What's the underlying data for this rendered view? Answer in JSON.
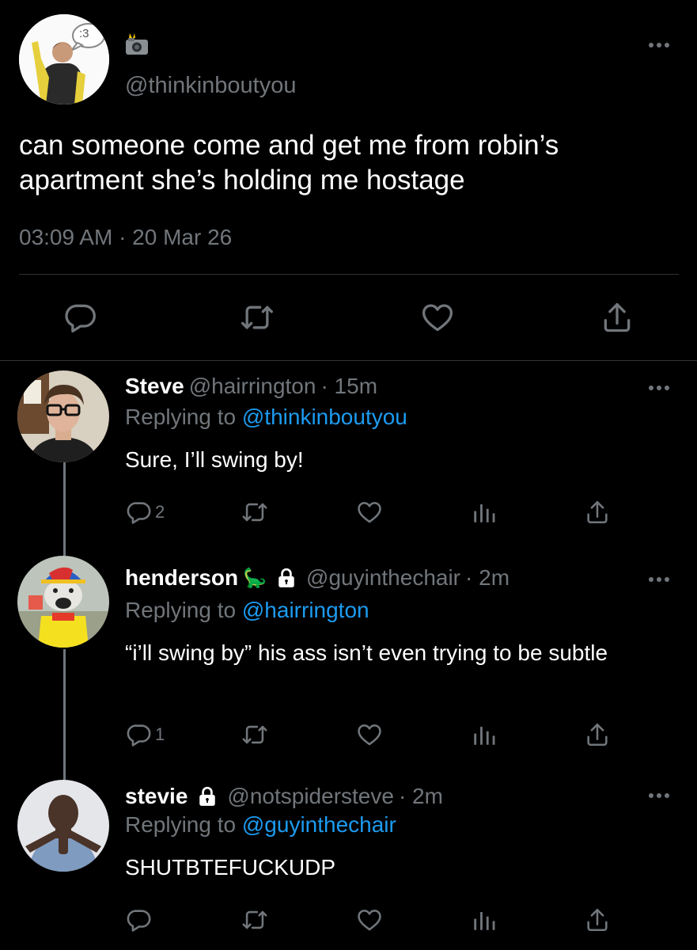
{
  "main_tweet": {
    "handle": "@thinkinboutyou",
    "avatar_bubble": ":3",
    "text": "can someone come and get me from robin’s apartment she’s holding me hostage",
    "timestamp": "03:09 AM · 20 Mar 26"
  },
  "replies": [
    {
      "name": "Steve",
      "handle": "@hairrington",
      "time": "· 15m",
      "replying_prefix": "Replying to",
      "replying_to": "@thinkinboutyou",
      "text": "Sure, I’ll swing by!",
      "reply_count": "2"
    },
    {
      "name": "henderson",
      "name_emoji": "🦕",
      "handle": "@guyinthechair",
      "time": "· 2m",
      "replying_prefix": "Replying to",
      "replying_to": "@hairrington",
      "text": "“i’ll swing by” his ass isn’t even trying to be subtle",
      "reply_count": "1"
    },
    {
      "name": "stevie",
      "handle": "@notspidersteve",
      "time": "· 2m",
      "replying_prefix": "Replying to",
      "replying_to": "@guyinthechair",
      "text": "SHUTBTEFUCKUDP",
      "reply_count": ""
    }
  ],
  "colors": {
    "background": "#000000",
    "muted": "#71767b",
    "link": "#1d9bf0",
    "divider": "#2f3336"
  }
}
